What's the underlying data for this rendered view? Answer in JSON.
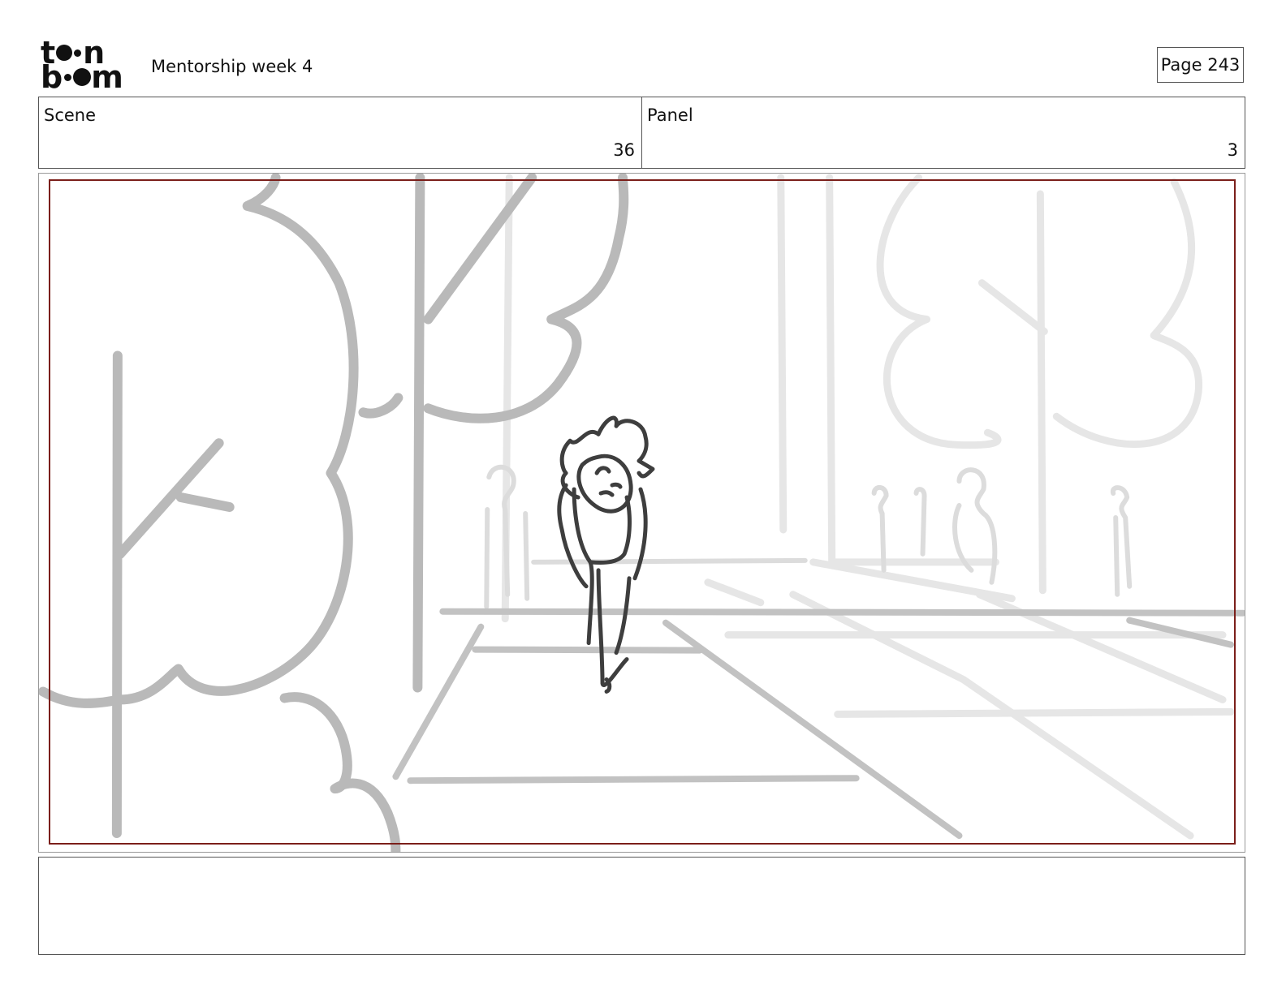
{
  "header": {
    "logo_text": "toon boom",
    "title": "Mentorship week 4",
    "page_label": "Page 243"
  },
  "info": {
    "scene_label": "Scene",
    "scene_value": "36",
    "panel_label": "Panel",
    "panel_value": "3"
  },
  "panel": {
    "frame_color": "#7b1f1a",
    "sketch": "rough storyboard drawing of a character walking through a park"
  },
  "notes": {
    "text": ""
  }
}
